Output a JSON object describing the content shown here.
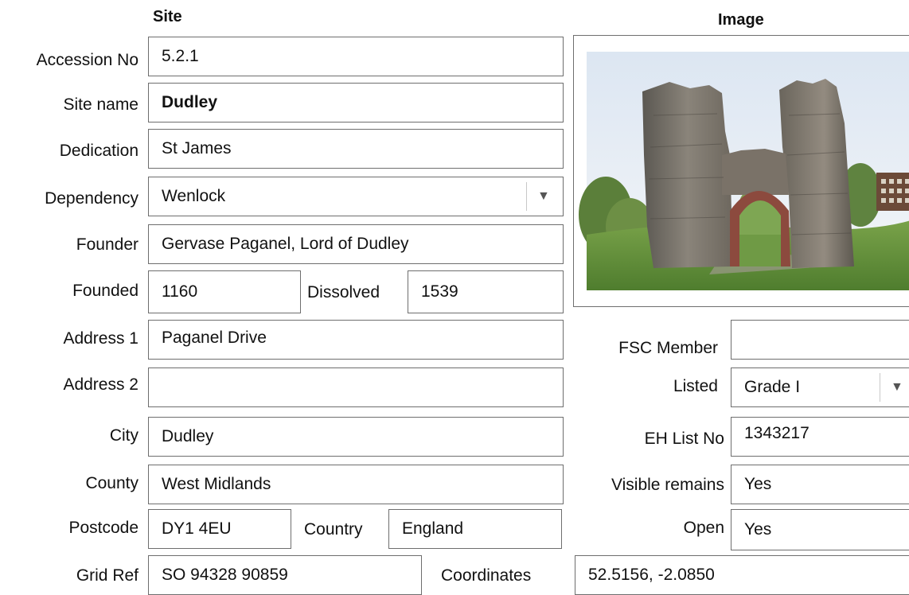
{
  "headers": {
    "site": "Site",
    "image": "Image"
  },
  "labels": {
    "accession_no": "Accession No",
    "site_name": "Site name",
    "dedication": "Dedication",
    "dependency": "Dependency",
    "founder": "Founder",
    "founded": "Founded",
    "dissolved": "Dissolved",
    "address1": "Address 1",
    "address2": "Address 2",
    "city": "City",
    "county": "County",
    "postcode": "Postcode",
    "country": "Country",
    "grid_ref": "Grid Ref",
    "coordinates": "Coordinates",
    "fsc_member": "FSC Member",
    "listed": "Listed",
    "eh_list_no": "EH List No",
    "visible_remains": "Visible remains",
    "open": "Open"
  },
  "values": {
    "accession_no": "5.2.1",
    "site_name": "Dudley",
    "dedication": "St James",
    "dependency": "Wenlock",
    "founder": "Gervase Paganel, Lord of Dudley",
    "founded": "1160",
    "dissolved": "1539",
    "address1": "Paganel Drive",
    "address2": "",
    "city": "Dudley",
    "county": "West Midlands",
    "postcode": "DY1 4EU",
    "country": "England",
    "grid_ref": "SO 94328 90859",
    "coordinates": "52.5156, -2.0850",
    "fsc_member": "",
    "listed": "Grade I",
    "eh_list_no": "1343217",
    "visible_remains": "Yes",
    "open": "Yes"
  },
  "icons": {
    "dropdown": "chevron-down-icon"
  }
}
